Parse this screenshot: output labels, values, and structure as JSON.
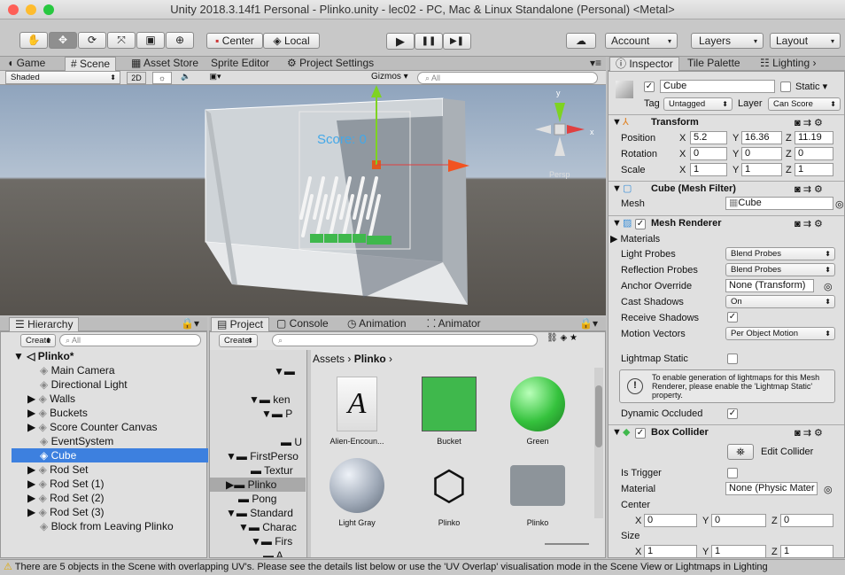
{
  "window": {
    "title": "Unity 2018.3.14f1 Personal - Plinko.unity - lec02 - PC, Mac & Linux Standalone (Personal) <Metal>"
  },
  "toolbar": {
    "center": "Center",
    "local": "Local",
    "play": "▶",
    "pause": "❚❚",
    "step": "▶❚",
    "account": "Account",
    "layers": "Layers",
    "layout": "Layout"
  },
  "scene_tabs": [
    "Game",
    "Scene",
    "Asset Store",
    "Sprite Editor",
    "Project Settings"
  ],
  "scene_toolbar": {
    "shading": "Shaded",
    "mode2d": "2D",
    "gizmos": "Gizmos",
    "search_placeholder": "All"
  },
  "scene_view": {
    "score_text": "Score: 0",
    "persp": "Persp"
  },
  "inspector": {
    "tabs": [
      "Inspector",
      "Tile Palette",
      "Lighting"
    ],
    "object_name": "Cube",
    "static_label": "Static",
    "tag_label": "Tag",
    "tag_value": "Untagged",
    "layer_label": "Layer",
    "layer_value": "Can Score",
    "transform": {
      "title": "Transform",
      "position": {
        "label": "Position",
        "x": "5.2",
        "y": "16.36",
        "z": "11.19"
      },
      "rotation": {
        "label": "Rotation",
        "x": "0",
        "y": "0",
        "z": "0"
      },
      "scale": {
        "label": "Scale",
        "x": "1",
        "y": "1",
        "z": "1"
      }
    },
    "mesh_filter": {
      "title": "Cube (Mesh Filter)",
      "mesh_label": "Mesh",
      "mesh_value": "Cube"
    },
    "mesh_renderer": {
      "title": "Mesh Renderer",
      "materials": "Materials",
      "light_probes": {
        "label": "Light Probes",
        "value": "Blend Probes"
      },
      "reflection_probes": {
        "label": "Reflection Probes",
        "value": "Blend Probes"
      },
      "anchor_override": {
        "label": "Anchor Override",
        "value": "None (Transform)"
      },
      "cast_shadows": {
        "label": "Cast Shadows",
        "value": "On"
      },
      "receive_shadows": {
        "label": "Receive Shadows"
      },
      "motion_vectors": {
        "label": "Motion Vectors",
        "value": "Per Object Motion"
      },
      "lightmap_static": {
        "label": "Lightmap Static"
      },
      "info": "To enable generation of lightmaps for this Mesh Renderer, please enable the 'Lightmap Static' property.",
      "dynamic_occluded": {
        "label": "Dynamic Occluded"
      }
    },
    "box_collider": {
      "title": "Box Collider",
      "edit_collider": "Edit Collider",
      "is_trigger": "Is Trigger",
      "material_label": "Material",
      "material_value": "None (Physic Mater",
      "center": {
        "label": "Center",
        "x": "0",
        "y": "0",
        "z": "0"
      },
      "size": {
        "label": "Size",
        "x": "1",
        "y": "1",
        "z": "1"
      }
    }
  },
  "hierarchy": {
    "tab": "Hierarchy",
    "create": "Create",
    "search_placeholder": "All",
    "scene_name": "Plinko*",
    "items": [
      "Main Camera",
      "Directional Light",
      "Walls",
      "Buckets",
      "Score Counter Canvas",
      "EventSystem",
      "Cube",
      "Rod Set",
      "Rod Set (1)",
      "Rod Set (2)",
      "Rod Set (3)",
      "Block from Leaving Plinko"
    ]
  },
  "project": {
    "tabs": [
      "Project",
      "Console",
      "Animation",
      "Animator"
    ],
    "create": "Create",
    "tree": [
      "ken",
      "P",
      "U",
      "FirstPerso",
      "Textur",
      "Plinko",
      "Pong",
      "Standard",
      "Charac",
      "Firs",
      "A"
    ],
    "breadcrumb": [
      "Assets",
      "Plinko"
    ],
    "assets": [
      "Alien-Encoun...",
      "Bucket",
      "Green",
      "Light Gray",
      "Plinko",
      "Plinko"
    ]
  },
  "status": {
    "message": "There are 5 objects in the Scene with overlapping UV's. Please see the details list below or use the 'UV Overlap' visualisation mode in the Scene View or Lightmaps in Lighting"
  },
  "colors": {
    "selection": "#3d80df",
    "accent_green": "#3fb84c",
    "warning": "#f0c000"
  }
}
